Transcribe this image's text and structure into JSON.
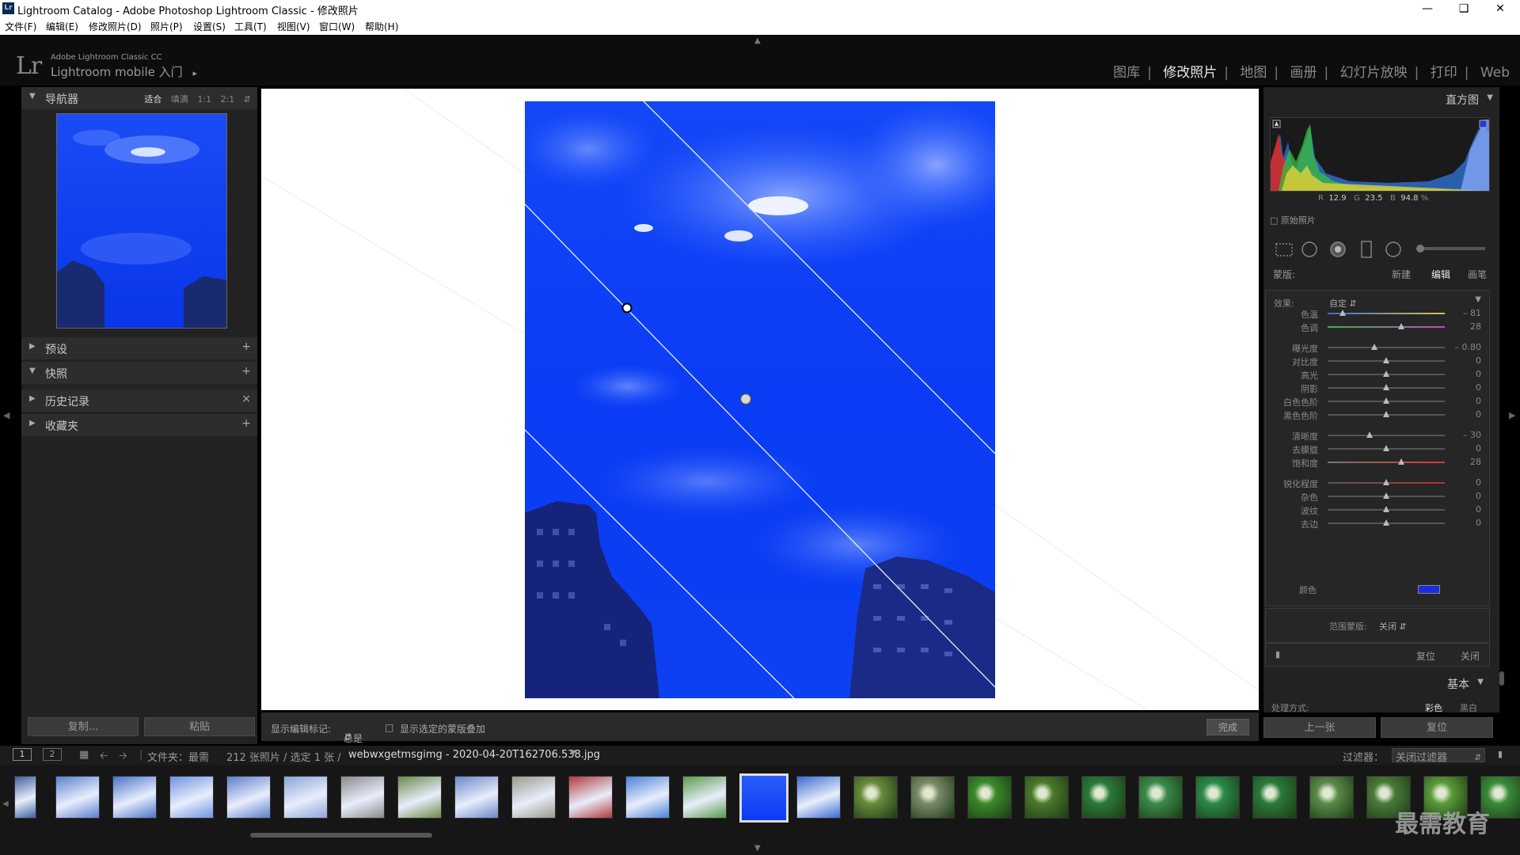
{
  "window": {
    "title": "Lightroom Catalog - Adobe Photoshop Lightroom Classic - 修改照片",
    "icon_label": "Lr",
    "minimize_icon": "minimize-icon",
    "maximize_icon": "maximize-icon",
    "close_icon": "close-icon"
  },
  "menu": [
    "文件(F)",
    "编辑(E)",
    "修改照片(D)",
    "照片(P)",
    "设置(S)",
    "工具(T)",
    "视图(V)",
    "窗口(W)",
    "帮助(H)"
  ],
  "identity": {
    "logo": "Lr",
    "product": "Adobe Lightroom Classic CC",
    "mobile": "Lightroom mobile 入门",
    "arrow": "▸"
  },
  "modules": [
    "图库",
    "修改照片",
    "地图",
    "画册",
    "幻灯片放映",
    "打印",
    "Web"
  ],
  "active_module": "修改照片",
  "left_panel": {
    "navigator": {
      "title": "导航器",
      "options": [
        "适合",
        "填满",
        "1:1",
        "2:1"
      ],
      "active_option": "适合"
    },
    "sections": [
      {
        "title": "预设",
        "action": "+"
      },
      {
        "title": "快照",
        "action": "+"
      },
      {
        "title": "历史记录",
        "action": "×"
      },
      {
        "title": "收藏夹",
        "action": "+"
      }
    ],
    "copy_button": "复制...",
    "paste_button": "粘贴"
  },
  "toolbar": {
    "show_edit_pins_label": "显示编辑标记:",
    "show_edit_pins_value": "总是",
    "show_mask_overlay": "显示选定的蒙版叠加",
    "done": "完成"
  },
  "right_panel": {
    "histogram_title": "直方图",
    "rgb": {
      "r_label": "R",
      "r": "12.9",
      "g_label": "G",
      "g": "23.5",
      "b_label": "B",
      "b": "94.8",
      "unit": "%"
    },
    "original_photo": "原始照片",
    "mask": {
      "label": "蒙版:",
      "new": "新建",
      "edit": "编辑",
      "brush": "画笔",
      "active": "编辑"
    },
    "effect": {
      "label": "效果:",
      "value": "自定"
    },
    "sliders": [
      {
        "name": "色温",
        "value": "– 81",
        "pos": 0.13
      },
      {
        "name": "色调",
        "value": "28",
        "pos": 0.63
      },
      {
        "name": "曝光度",
        "value": "– 0.80",
        "pos": 0.4
      },
      {
        "name": "对比度",
        "value": "0",
        "pos": 0.5
      },
      {
        "name": "高光",
        "value": "0",
        "pos": 0.5
      },
      {
        "name": "阴影",
        "value": "0",
        "pos": 0.5
      },
      {
        "name": "白色色阶",
        "value": "0",
        "pos": 0.5
      },
      {
        "name": "黑色色阶",
        "value": "0",
        "pos": 0.5
      },
      {
        "name": "清晰度",
        "value": "– 30",
        "pos": 0.36
      },
      {
        "name": "去朦胧",
        "value": "0",
        "pos": 0.5
      },
      {
        "name": "饱和度",
        "value": "28",
        "pos": 0.63
      },
      {
        "name": "锐化程度",
        "value": "0",
        "pos": 0.5
      },
      {
        "name": "杂色",
        "value": "0",
        "pos": 0.5
      },
      {
        "name": "波纹",
        "value": "0",
        "pos": 0.5
      },
      {
        "name": "去边",
        "value": "0",
        "pos": 0.5
      }
    ],
    "color_label": "颜色",
    "color_swatch": "#1a2ee0",
    "range_mask_label": "范围蒙版:",
    "range_mask_value": "关闭",
    "reset": "复位",
    "close": "关闭",
    "basic_title": "基本",
    "treatment_label": "处理方式:",
    "treatment_color": "彩色",
    "treatment_bw": "黑白",
    "prev_button": "上一张",
    "reset_button": "复位"
  },
  "filmbar": {
    "view1": "1",
    "view2": "2",
    "folder_label": "文件夹：最需",
    "count": "212 张照片 / 选定 1 张 /",
    "filename": "webwxgetmsgimg - 2020-04-20T162706.538.jpg",
    "filter_label": "过滤器：",
    "filter_value": "关闭过滤器"
  },
  "watermark": "最需教育",
  "colors": {
    "sky": "#0a3cf5",
    "accent": "#e8e8e8"
  }
}
